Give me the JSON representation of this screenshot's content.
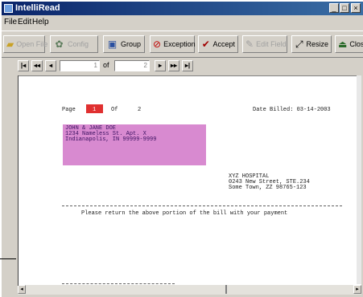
{
  "window": {
    "title": "IntelliRead",
    "controls": {
      "minimize": "_",
      "maximize": "□",
      "close": "×"
    }
  },
  "menu": {
    "items": [
      "File",
      "Edit",
      "Help"
    ]
  },
  "toolbar": {
    "buttons": [
      {
        "label": "Open File",
        "icon": "folder-open-icon",
        "enabled": false
      },
      {
        "label": "Config",
        "icon": "gears-icon",
        "enabled": false
      },
      {
        "label": "Group",
        "icon": "group-icon",
        "enabled": true
      },
      {
        "label": "Exception",
        "icon": "no-entry-icon",
        "enabled": true
      },
      {
        "label": "Accept",
        "icon": "checkmark-icon",
        "enabled": true
      },
      {
        "label": "Edit Field",
        "icon": "edit-icon",
        "enabled": false
      },
      {
        "label": "Resize",
        "icon": "resize-icon",
        "enabled": true
      },
      {
        "label": "Close",
        "icon": "close-icon",
        "enabled": true
      }
    ]
  },
  "navigation": {
    "first": "|◂",
    "prev_fast": "◂◂",
    "prev": "◂",
    "current_page": "1",
    "of_label": "of",
    "total_pages": "2",
    "next": "▸",
    "next_fast": "▸▸",
    "last": "▸|"
  },
  "document": {
    "page_label": "Page",
    "page_number": "1",
    "of_label": "Of",
    "page_total": "2",
    "date_billed": "Date Billed: 03-14-2003",
    "address": [
      "JOHN & JANE DOE",
      "1234 Nameless St. Apt. X",
      "Indianapolis, IN 99999-9999"
    ],
    "hospital": [
      "XYZ HOSPITAL",
      "0243 New Street, STE.234",
      "Some Town, ZZ 98765-123"
    ],
    "return_note": "Please return the above portion of the bill with your payment"
  },
  "colors": {
    "title_bar_start": "#0a246a",
    "title_bar_end": "#3a6ea5",
    "page_highlight": "#e03030",
    "address_highlight": "#d88ad0"
  }
}
